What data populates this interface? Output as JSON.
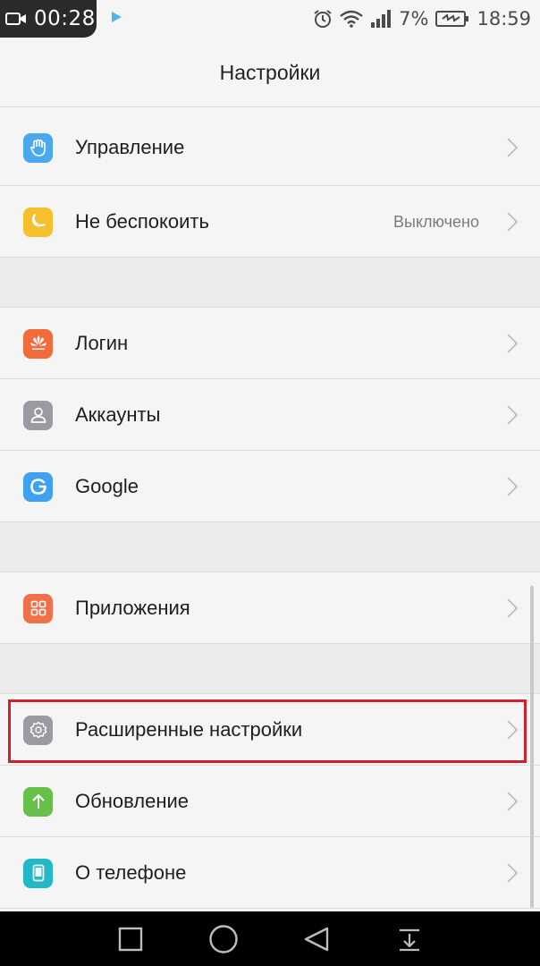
{
  "status_bar": {
    "recording_time": "00:28",
    "battery_percent": "7%",
    "clock": "18:59",
    "icons": [
      "video-camera-icon",
      "play-icon",
      "alarm-icon",
      "wifi-icon",
      "signal-icon",
      "battery-charging-icon"
    ]
  },
  "header": {
    "title": "Настройки"
  },
  "colors": {
    "accent_highlight": "#d0202a",
    "control_icon": "#4aa8ee",
    "dnd_icon": "#f6c02a",
    "login_icon": "#f26b3a",
    "accounts_icon": "#9a9aa0",
    "google_icon": "#3ea2f0",
    "apps_icon": "#f0704a",
    "advanced_icon": "#9a9aa0",
    "update_icon": "#67c04a",
    "about_icon": "#22b8c6"
  },
  "settings": {
    "control": {
      "label": "Управление",
      "icon": "hand-icon"
    },
    "dnd": {
      "label": "Не беспокоить",
      "value": "Выключено",
      "icon": "moon-icon"
    },
    "login": {
      "label": "Логин",
      "icon": "huawei-logo-icon"
    },
    "accounts": {
      "label": "Аккаунты",
      "icon": "person-icon"
    },
    "google": {
      "label": "Google",
      "icon": "google-g-icon"
    },
    "apps": {
      "label": "Приложения",
      "icon": "apps-grid-icon"
    },
    "advanced": {
      "label": "Расширенные настройки",
      "icon": "gear-icon"
    },
    "update": {
      "label": "Обновление",
      "icon": "arrow-up-icon"
    },
    "about": {
      "label": "О телефоне",
      "icon": "phone-icon"
    }
  },
  "nav_bar": {
    "buttons": [
      "recents-square-icon",
      "home-circle-icon",
      "back-triangle-icon",
      "notification-pull-icon"
    ]
  }
}
